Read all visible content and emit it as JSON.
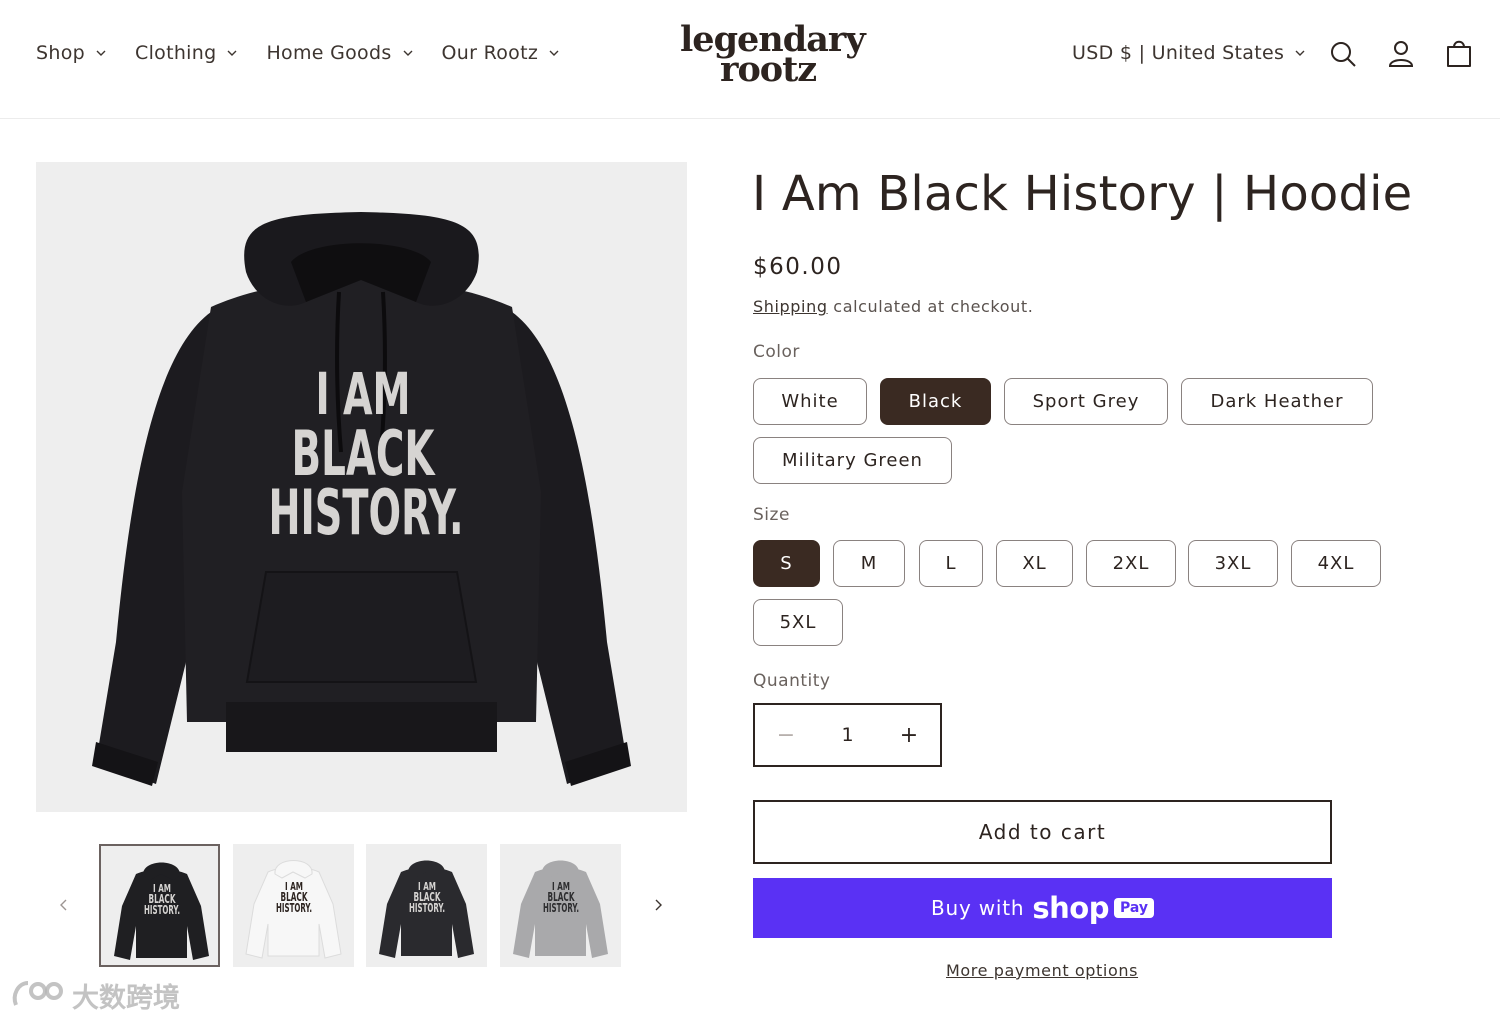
{
  "nav": {
    "items": [
      {
        "label": "Shop"
      },
      {
        "label": "Clothing"
      },
      {
        "label": "Home Goods"
      },
      {
        "label": "Our Rootz"
      }
    ]
  },
  "logo": {
    "line1": "legendary",
    "line2": "rootz"
  },
  "header": {
    "currency": "USD $ | United States"
  },
  "gallery": {
    "main_print": [
      "I AM",
      "BLACK",
      "HISTORY."
    ],
    "thumb_print": [
      "I AM",
      "BLACK",
      "HISTORY."
    ],
    "thumb_colors": [
      "#1f1f22",
      "#f7f7f7",
      "#2a2a2e",
      "#a9a9ab"
    ],
    "prev_icon": "chevron-left-icon",
    "next_icon": "chevron-right-icon"
  },
  "product": {
    "title": "I Am Black History | Hoodie",
    "price": "$60.00",
    "shipping_link": "Shipping",
    "shipping_text": " calculated at checkout.",
    "color_label": "Color",
    "colors": [
      "White",
      "Black",
      "Sport Grey",
      "Dark Heather",
      "Military Green"
    ],
    "selected_color": "Black",
    "size_label": "Size",
    "sizes": [
      "S",
      "M",
      "L",
      "XL",
      "2XL",
      "3XL",
      "4XL",
      "5XL"
    ],
    "selected_size": "S",
    "quantity_label": "Quantity",
    "quantity": "1",
    "minus": "−",
    "plus": "+",
    "add_to_cart": "Add to cart",
    "buy_with": "Buy with",
    "shop": "shop",
    "pay": "Pay",
    "more_payment": "More payment options"
  },
  "watermark": {
    "text": "大数跨境"
  },
  "colors": {
    "accent": "#3a2a22",
    "shop_pay": "#5a31f4",
    "image_bg": "#eeeeee"
  }
}
